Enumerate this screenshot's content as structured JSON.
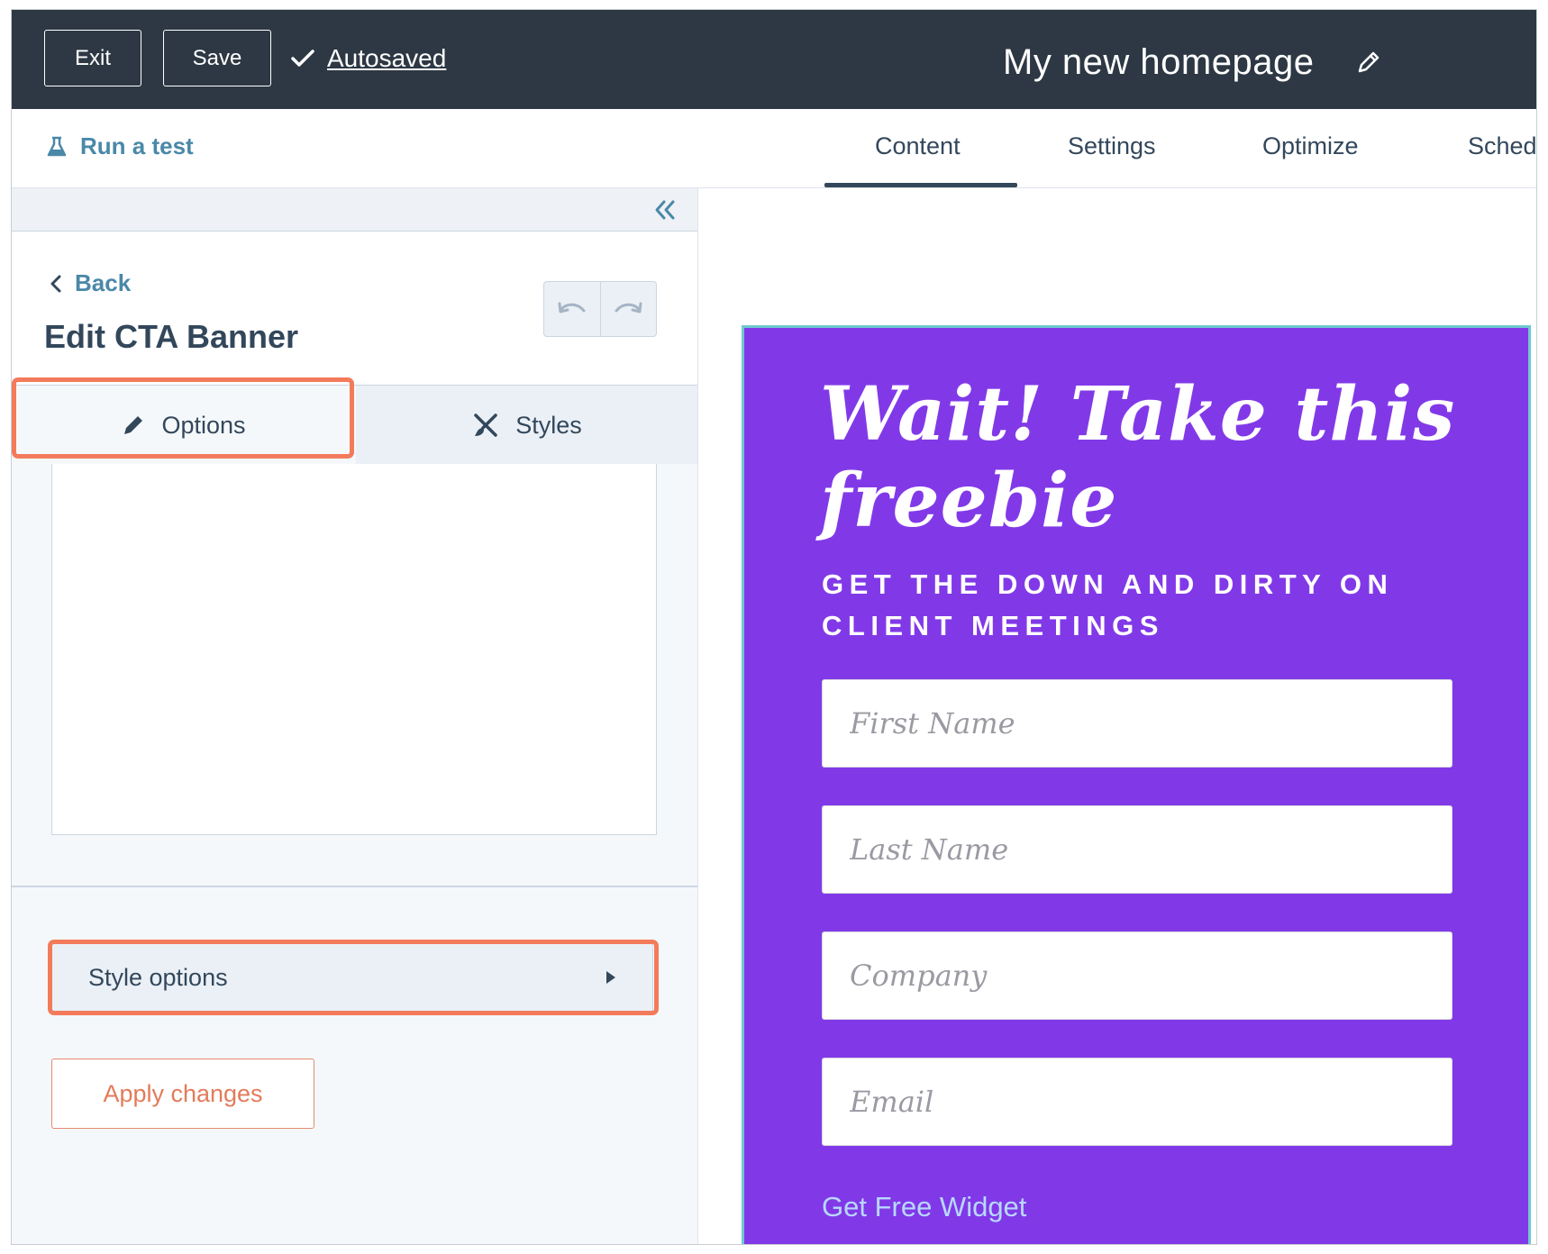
{
  "topbar": {
    "exit_label": "Exit",
    "save_label": "Save",
    "autosaved_label": "Autosaved",
    "page_name": "My new homepage"
  },
  "tabs_row": {
    "run_test_label": "Run a test",
    "tabs": [
      {
        "label": "Content",
        "active": true
      },
      {
        "label": "Settings",
        "active": false
      },
      {
        "label": "Optimize",
        "active": false
      },
      {
        "label": "Sched",
        "active": false
      }
    ]
  },
  "panel": {
    "back_label": "Back",
    "title": "Edit CTA Banner",
    "tabs": [
      {
        "label": "Options",
        "active": true
      },
      {
        "label": "Styles",
        "active": false
      }
    ],
    "style_options_label": "Style options",
    "apply_label": "Apply changes"
  },
  "preview": {
    "heading": "Wait! Take this freebie",
    "subheading": "GET THE DOWN AND DIRTY ON CLIENT MEETINGS",
    "fields": [
      {
        "placeholder": "First Name"
      },
      {
        "placeholder": "Last Name"
      },
      {
        "placeholder": "Company"
      },
      {
        "placeholder": "Email"
      }
    ],
    "link_label": "Get Free Widget"
  },
  "colors": {
    "topbar_bg": "#2d3844",
    "banner_bg": "#8139e8",
    "highlight": "#f37b5b",
    "link_blue": "#4a88a8"
  }
}
